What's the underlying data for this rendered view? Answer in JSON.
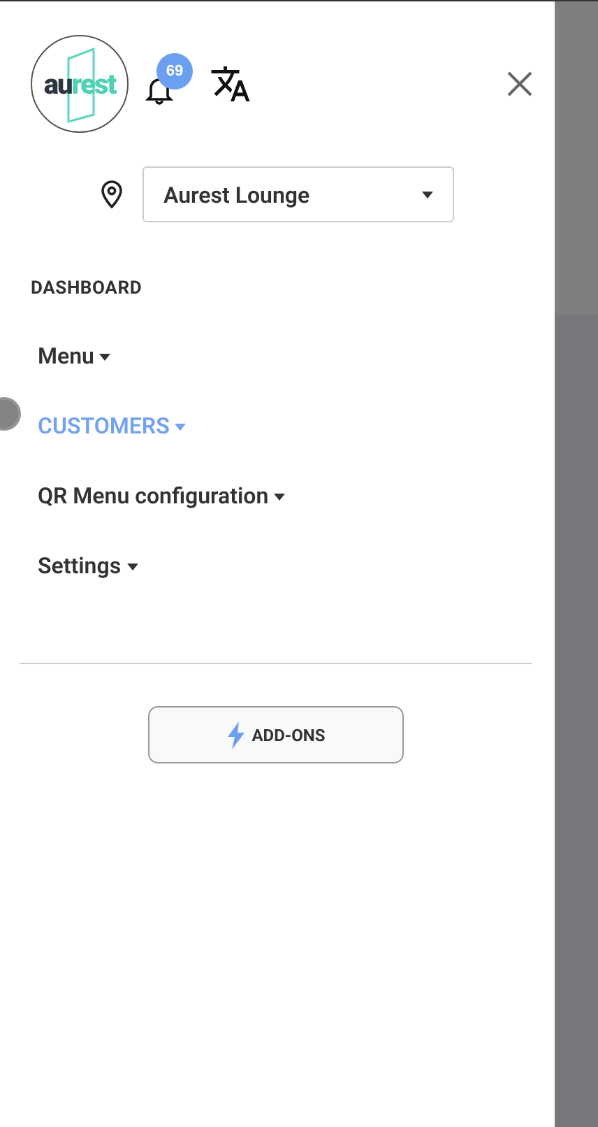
{
  "logo": {
    "dark": "au",
    "accent": "rest"
  },
  "notifications": {
    "count": "69"
  },
  "location": {
    "value": "Aurest Lounge"
  },
  "section_title": "DASHBOARD",
  "nav_items": [
    {
      "label": "Menu",
      "selected": false
    },
    {
      "label": "CUSTOMERS",
      "selected": true
    },
    {
      "label": "QR Menu configuration",
      "selected": false
    },
    {
      "label": "Settings",
      "selected": false
    }
  ],
  "addons_button": {
    "label": "ADD-ONS"
  }
}
